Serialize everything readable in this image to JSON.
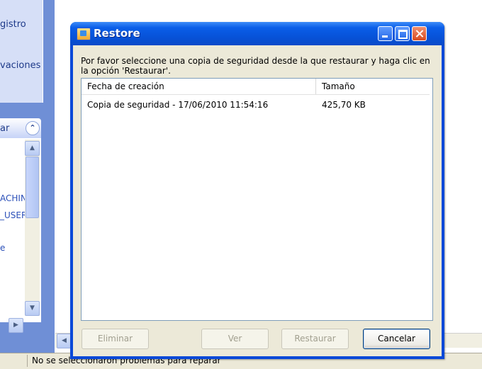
{
  "background": {
    "taskbox_lines": [
      "gistro",
      "vaciones"
    ],
    "taskhead_label": "ar",
    "tree_items": [
      "ACHIN",
      "_USER",
      "e"
    ],
    "status_text": "No se seleccionaron problemas para reparar"
  },
  "dialog": {
    "title": "Restore",
    "instructions": "Por favor seleccione una copia de seguridad desde la que restaurar y haga clic en la opción 'Restaurar'.",
    "columns": [
      "Fecha de creación",
      "Tamaño"
    ],
    "rows": [
      {
        "name": "Copia de seguridad - 17/06/2010 11:54:16",
        "size": "425,70 KB"
      }
    ],
    "buttons": {
      "delete": "Eliminar",
      "view": "Ver",
      "restore": "Restaurar",
      "cancel": "Cancelar"
    }
  }
}
